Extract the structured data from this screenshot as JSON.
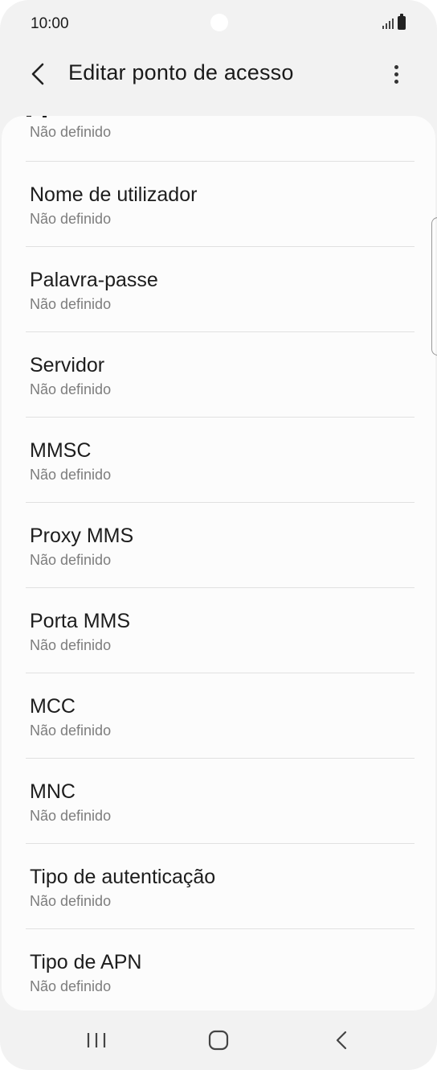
{
  "status_bar": {
    "time": "10:00"
  },
  "header": {
    "title": "Editar ponto de acesso"
  },
  "list": {
    "partial_top_value": "Não definido",
    "items": [
      {
        "title": "Nome de utilizador",
        "value": "Não definido"
      },
      {
        "title": "Palavra-passe",
        "value": "Não definido"
      },
      {
        "title": "Servidor",
        "value": "Não definido"
      },
      {
        "title": "MMSC",
        "value": "Não definido"
      },
      {
        "title": "Proxy MMS",
        "value": "Não definido"
      },
      {
        "title": "Porta MMS",
        "value": "Não definido"
      },
      {
        "title": "MCC",
        "value": "Não definido"
      },
      {
        "title": "MNC",
        "value": "Não definido"
      },
      {
        "title": "Tipo de autenticação",
        "value": "Não definido"
      },
      {
        "title": "Tipo de APN",
        "value": "Não definido"
      }
    ]
  },
  "icons": {
    "back": "chevron-left-icon",
    "more": "more-vertical-icon",
    "recents": "recent-apps-icon",
    "home": "home-icon",
    "nav_back": "nav-back-icon"
  }
}
